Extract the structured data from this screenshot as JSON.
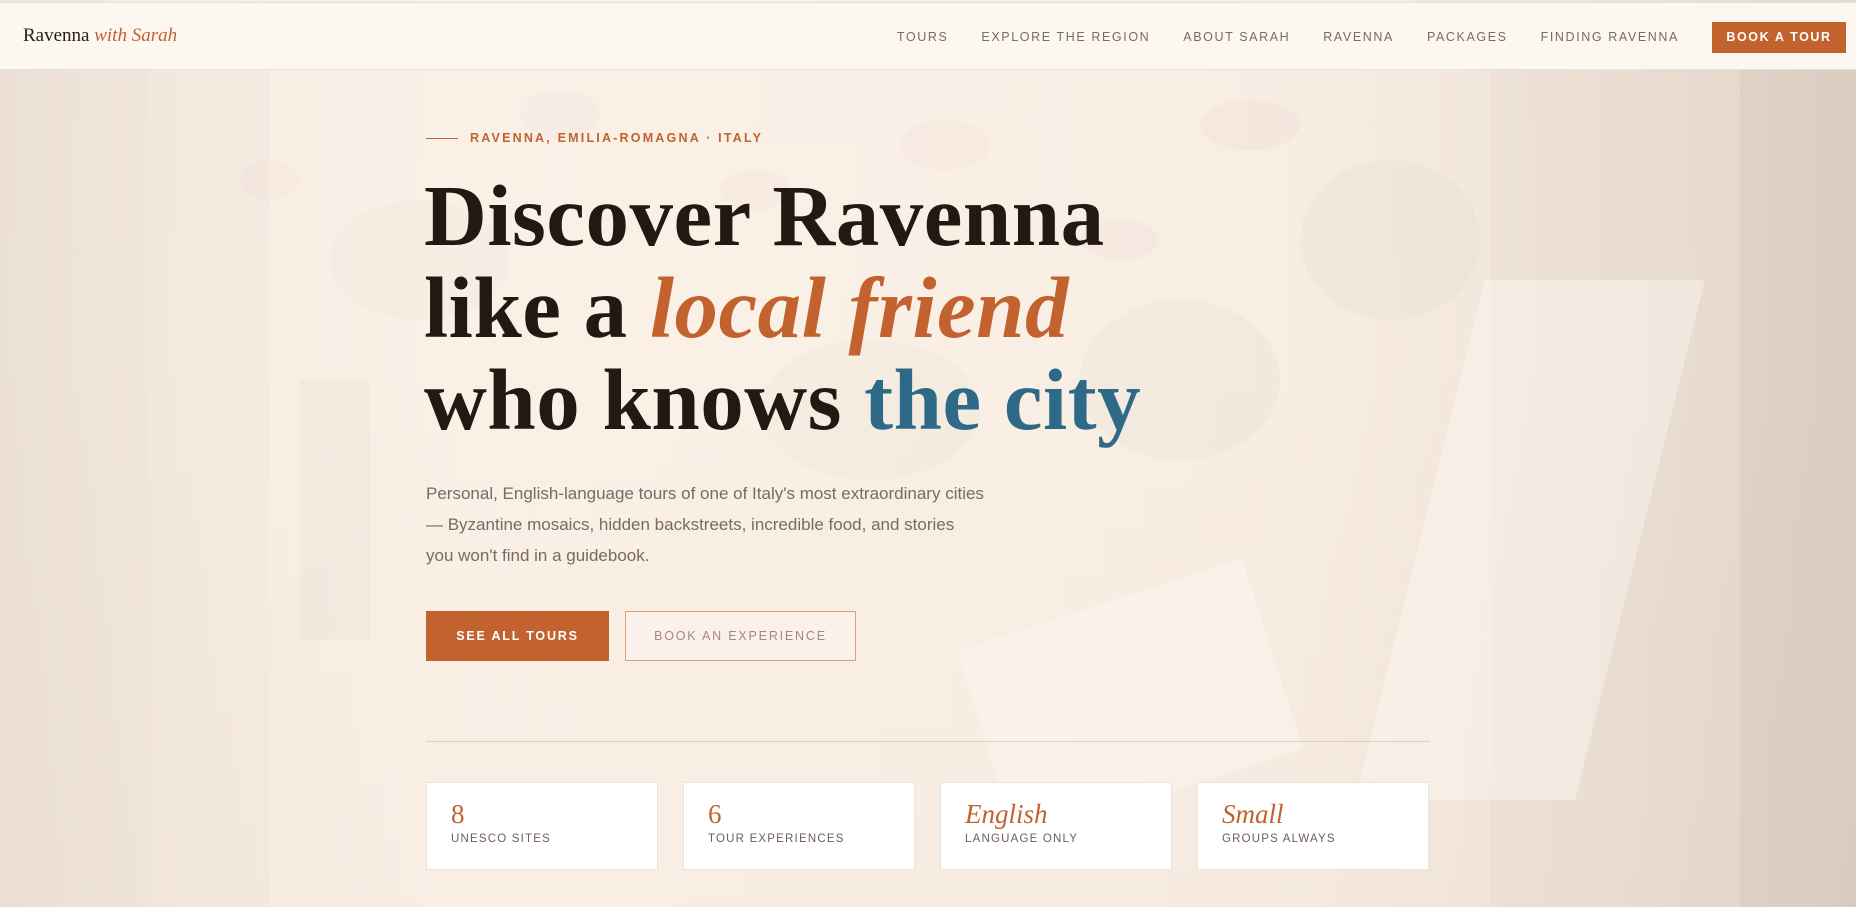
{
  "nav": {
    "brand": {
      "name": "Ravenna",
      "accent": "with Sarah"
    },
    "links": [
      "TOURS",
      "EXPLORE THE REGION",
      "ABOUT SARAH",
      "RAVENNA",
      "PACKAGES",
      "FINDING RAVENNA"
    ],
    "cta": "BOOK A TOUR"
  },
  "hero": {
    "eyebrow": "RAVENNA, EMILIA-ROMAGNA · ITALY",
    "headline": {
      "line1": "Discover Ravenna",
      "line2_plain": "like a ",
      "line2_accent": "local friend",
      "line3_plain": "who knows ",
      "line3_accent": "the city"
    },
    "lede": "Personal, English-language tours of one of Italy's most extraordinary cities — Byzantine mosaics, hidden backstreets, incredible food, and stories you won't find in a guidebook.",
    "primary_cta": "SEE ALL TOURS",
    "secondary_cta": "BOOK AN EXPERIENCE"
  },
  "stats": [
    {
      "value": "8",
      "label": "UNESCO SITES"
    },
    {
      "value": "6",
      "label": "TOUR EXPERIENCES"
    },
    {
      "value": "English",
      "label": "LANGUAGE ONLY"
    },
    {
      "value": "Small",
      "label": "GROUPS ALWAYS"
    }
  ],
  "colors": {
    "accent": "#c2622e",
    "blue": "#2e6a88",
    "ink": "#241812"
  }
}
